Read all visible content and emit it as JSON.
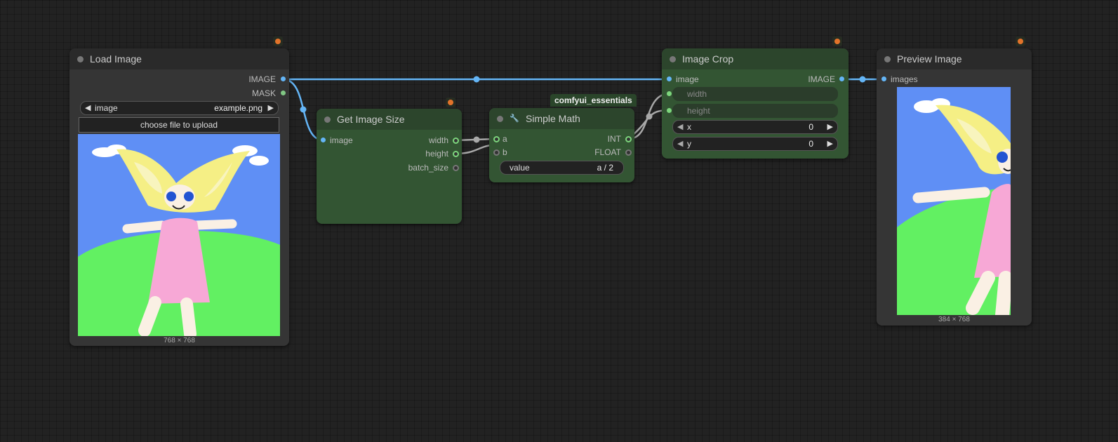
{
  "nodes": {
    "load_image": {
      "title": "Load Image",
      "outputs": [
        "IMAGE",
        "MASK"
      ],
      "image_widget": {
        "label": "image",
        "value": "example.png"
      },
      "upload_label": "choose file to upload",
      "image_size": "768 × 768"
    },
    "get_image_size": {
      "title": "Get Image Size",
      "inputs": [
        "image"
      ],
      "outputs": [
        "width",
        "height",
        "batch_size"
      ]
    },
    "simple_math": {
      "title": "Simple Math",
      "group_tag": "comfyui_essentials",
      "icon": "wrench-icon",
      "inputs": [
        "a",
        "b"
      ],
      "outputs": [
        "INT",
        "FLOAT"
      ],
      "value_widget": {
        "label": "value",
        "value": "a / 2"
      }
    },
    "image_crop": {
      "title": "Image Crop",
      "inputs": [
        "image",
        "width",
        "height"
      ],
      "outputs": [
        "IMAGE"
      ],
      "x_widget": {
        "label": "x",
        "value": "0"
      },
      "y_widget": {
        "label": "y",
        "value": "0"
      }
    },
    "preview_image": {
      "title": "Preview Image",
      "inputs": [
        "images"
      ],
      "image_size": "384 × 768"
    }
  },
  "colors": {
    "image_link": "#64b5f6",
    "int_link": "#a8a8a8",
    "node_gray": "#353535",
    "node_green": "#335533"
  }
}
